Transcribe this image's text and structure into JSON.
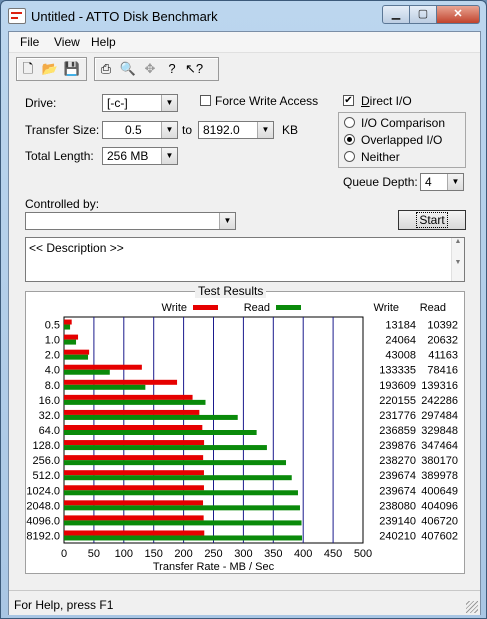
{
  "window": {
    "title": "Untitled - ATTO Disk Benchmark",
    "caption_buttons": {
      "minimize": "▁",
      "maximize": "▢",
      "close": "✕"
    }
  },
  "menu": [
    "File",
    "View",
    "Help"
  ],
  "toolbar": {
    "icons": [
      "new-icon",
      "open-icon",
      "save-icon",
      "print-icon",
      "print-preview-icon",
      "move-icon",
      "help-icon",
      "context-help-icon"
    ]
  },
  "settings": {
    "drive_label": "Drive:",
    "drive_value": "[-c-]",
    "force_write_label": "Force Write Access",
    "force_write_checked": false,
    "direct_io_label": "Direct I/O",
    "direct_io_checked": true,
    "transfer_size_label": "Transfer Size:",
    "transfer_from": "0.5",
    "to_label": "to",
    "transfer_to": "8192.0",
    "transfer_unit": "KB",
    "total_length_label": "Total Length:",
    "total_length_value": "256 MB",
    "io_options": [
      "I/O Comparison",
      "Overlapped I/O",
      "Neither"
    ],
    "io_selected": "Overlapped I/O",
    "queue_depth_label": "Queue Depth:",
    "queue_depth_value": "4",
    "controlled_by_label": "Controlled by:",
    "controlled_by_value": "",
    "start_label": "Start",
    "description": "<< Description >>"
  },
  "results": {
    "title": "Test Results",
    "legend_write": "Write",
    "legend_read": "Read",
    "col_write": "Write",
    "col_read": "Read",
    "colors": {
      "write": "#e60000",
      "read": "#0a8a0a"
    }
  },
  "chart_data": {
    "type": "bar",
    "orientation": "horizontal",
    "title": "Test Results",
    "xlabel": "Transfer Rate - MB / Sec",
    "ylabel": "",
    "xlim": [
      0,
      500
    ],
    "xticks": [
      0,
      50,
      100,
      150,
      200,
      250,
      300,
      350,
      400,
      450,
      500
    ],
    "grid": true,
    "legend": "top",
    "categories": [
      "0.5",
      "1.0",
      "2.0",
      "4.0",
      "8.0",
      "16.0",
      "32.0",
      "64.0",
      "128.0",
      "256.0",
      "512.0",
      "1024.0",
      "2048.0",
      "4096.0",
      "8192.0"
    ],
    "series": [
      {
        "name": "Write",
        "color": "#e60000",
        "values": [
          13184,
          24064,
          43008,
          133335,
          193609,
          220155,
          231776,
          236859,
          239876,
          238270,
          239674,
          239674,
          238080,
          239140,
          240210
        ]
      },
      {
        "name": "Read",
        "color": "#0a8a0a",
        "values": [
          10392,
          20632,
          41163,
          78416,
          139316,
          242286,
          297484,
          329848,
          347464,
          380170,
          389978,
          400649,
          404096,
          406720,
          407602
        ]
      }
    ],
    "units_note_values": "KB/s"
  },
  "status": {
    "text": "For Help, press F1"
  }
}
